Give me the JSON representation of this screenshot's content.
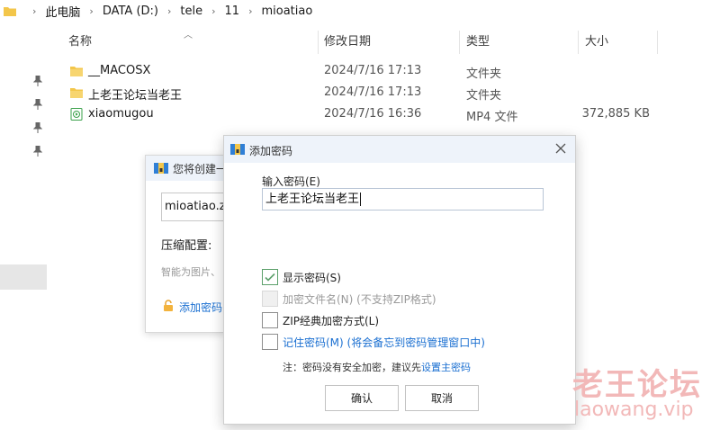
{
  "breadcrumb": [
    "此电脑",
    "DATA (D:)",
    "tele",
    "11",
    "mioatiao"
  ],
  "columns": {
    "name": "名称",
    "date": "修改日期",
    "type": "类型",
    "size": "大小"
  },
  "files": [
    {
      "name": "__MACOSX",
      "date": "2024/7/16 17:13",
      "type": "文件夹",
      "size": "",
      "icon": "folder-icon"
    },
    {
      "name": "上老王论坛当老王",
      "date": "2024/7/16 17:13",
      "type": "文件夹",
      "size": "",
      "icon": "folder-icon"
    },
    {
      "name": "xiaomugou",
      "date": "2024/7/16 16:36",
      "type": "MP4 文件",
      "size": "372,885 KB",
      "icon": "video-file-icon"
    }
  ],
  "bg_dialog": {
    "title": "您将创建一",
    "filename": "mioatiao.zi",
    "compress_label": "压缩配置:",
    "hint": "智能为图片、",
    "add_password_link": "添加密码"
  },
  "dialog": {
    "title": "添加密码",
    "input_label": "输入密码(E)",
    "password_value": "上老王论坛当老王",
    "options": [
      {
        "label": "显示密码(S)",
        "checked": true,
        "disabled": false,
        "link": false
      },
      {
        "label": "加密文件名(N) (不支持ZIP格式)",
        "checked": false,
        "disabled": true,
        "link": false
      },
      {
        "label": "ZIP经典加密方式(L)",
        "checked": false,
        "disabled": false,
        "link": false
      },
      {
        "label": "记住密码(M) (将会备忘到密码管理窗口中)",
        "checked": false,
        "disabled": false,
        "link": true
      }
    ],
    "note_text": "注：密码没有安全加密，建议先",
    "note_link": "设置主密码",
    "ok_label": "确认",
    "cancel_label": "取消"
  },
  "watermark": {
    "line1": "老王论坛",
    "line2": "laowang.vip"
  },
  "colors": {
    "accent": "#1a6fd1",
    "check": "#5ca06b",
    "folder": "#f3c64a",
    "watermark": "#f2b8b8"
  }
}
